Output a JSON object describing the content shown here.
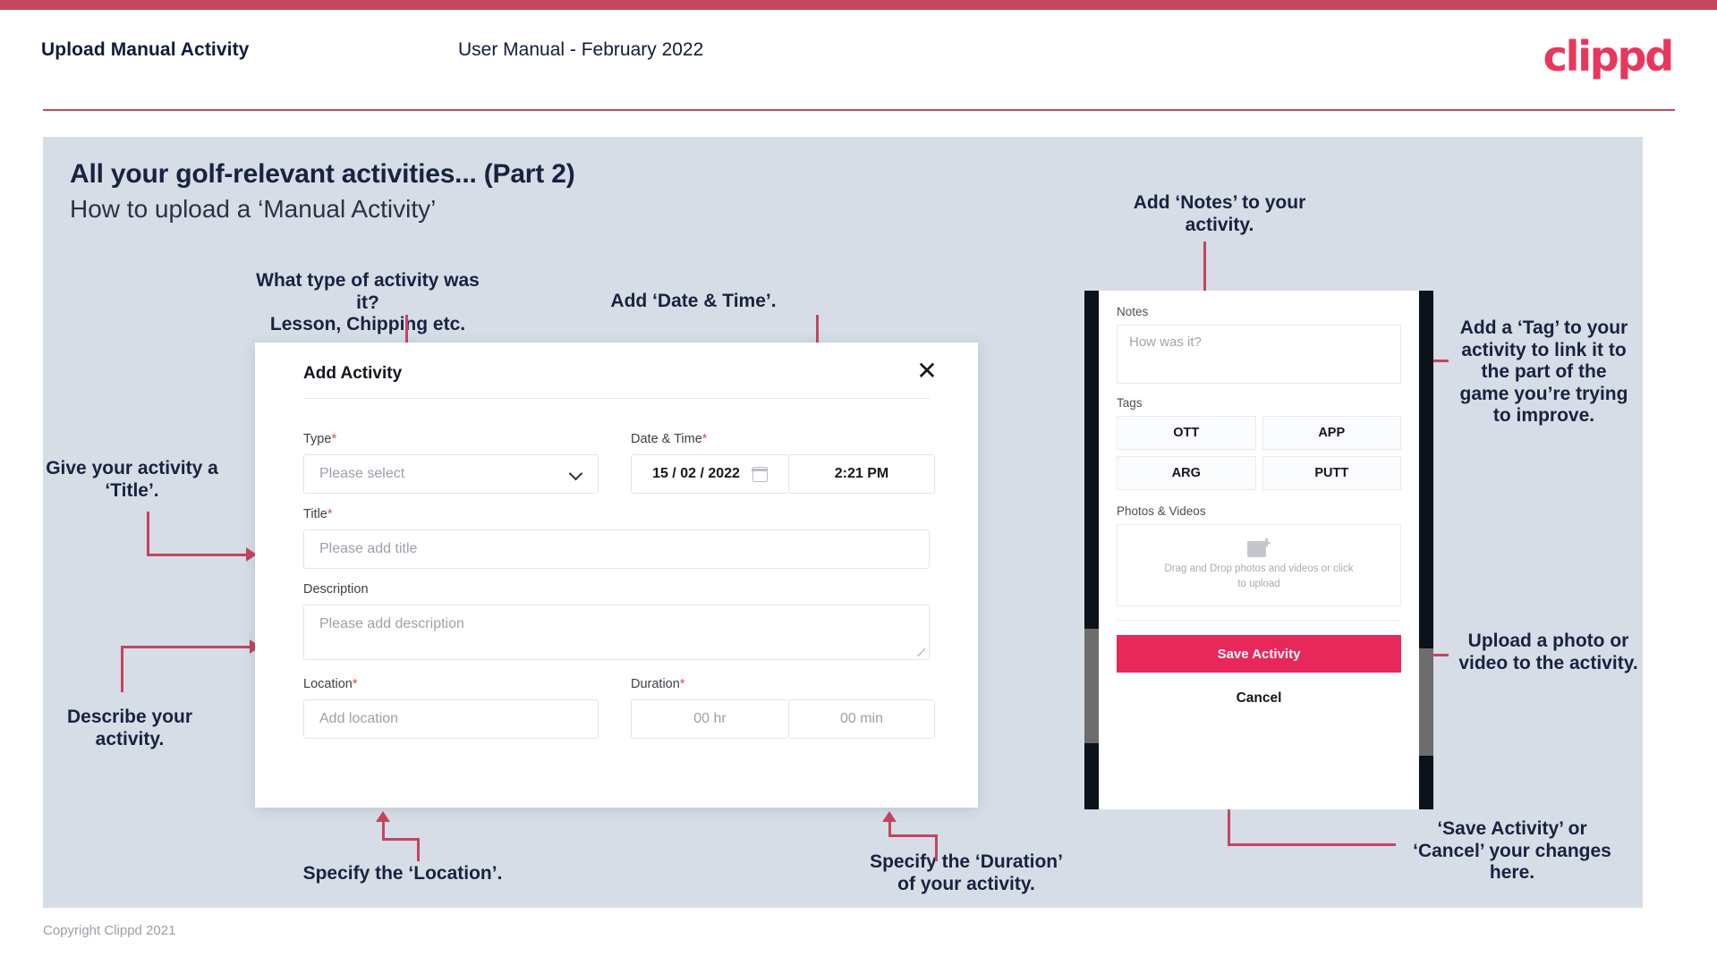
{
  "header": {
    "title": "Upload Manual Activity",
    "subtitle": "User Manual - February 2022",
    "logo": "clippd"
  },
  "slide": {
    "title": "All your golf-relevant activities... (Part 2)",
    "subtitle": "How to upload a ‘Manual Activity’"
  },
  "dialog": {
    "title": "Add Activity",
    "close_icon": "✕",
    "fields": {
      "type": {
        "label": "Type",
        "required": "*",
        "value": "Please select"
      },
      "datetime": {
        "label": "Date & Time",
        "required": "*",
        "date": "15 /  02  / 2022",
        "time": "2:21 PM"
      },
      "title": {
        "label": "Title",
        "required": "*",
        "placeholder": "Please add title"
      },
      "description": {
        "label": "Description",
        "required": "",
        "placeholder": "Please add description"
      },
      "location": {
        "label": "Location",
        "required": "*",
        "placeholder": "Add location"
      },
      "duration": {
        "label": "Duration",
        "required": "*",
        "hours": "00 hr",
        "minutes": "00 min"
      }
    }
  },
  "mobile": {
    "notes_label": "Notes",
    "notes_placeholder": "How was it?",
    "tags_label": "Tags",
    "tags": [
      "OTT",
      "APP",
      "ARG",
      "PUTT"
    ],
    "photos_label": "Photos & Videos",
    "drop_text": "Drag and Drop photos and videos or click to upload",
    "save_label": "Save Activity",
    "cancel_label": "Cancel"
  },
  "annotations": {
    "type": "What type of activity was it?\nLesson, Chipping etc.",
    "datetime": "Add ‘Date & Time’.",
    "title": "Give your activity a\n‘Title’.",
    "description": "Describe your\nactivity.",
    "location": "Specify the ‘Location’.",
    "duration": "Specify the ‘Duration’\nof your activity.",
    "notes": "Add ‘Notes’ to your\nactivity.",
    "tags": "Add a ‘Tag’ to your\nactivity to link it to\nthe part of the\ngame you’re trying\nto improve.",
    "upload": "Upload a photo or\nvideo to the activity.",
    "save": "‘Save Activity’ or\n‘Cancel’ your changes\nhere."
  },
  "footer": {
    "copyright": "Copyright Clippd 2021"
  },
  "colors": {
    "accent": "#e8275a",
    "bar": "#c8475f",
    "panel": "#d7dde6",
    "arrow": "#c4455f",
    "heading": "#17233f"
  }
}
